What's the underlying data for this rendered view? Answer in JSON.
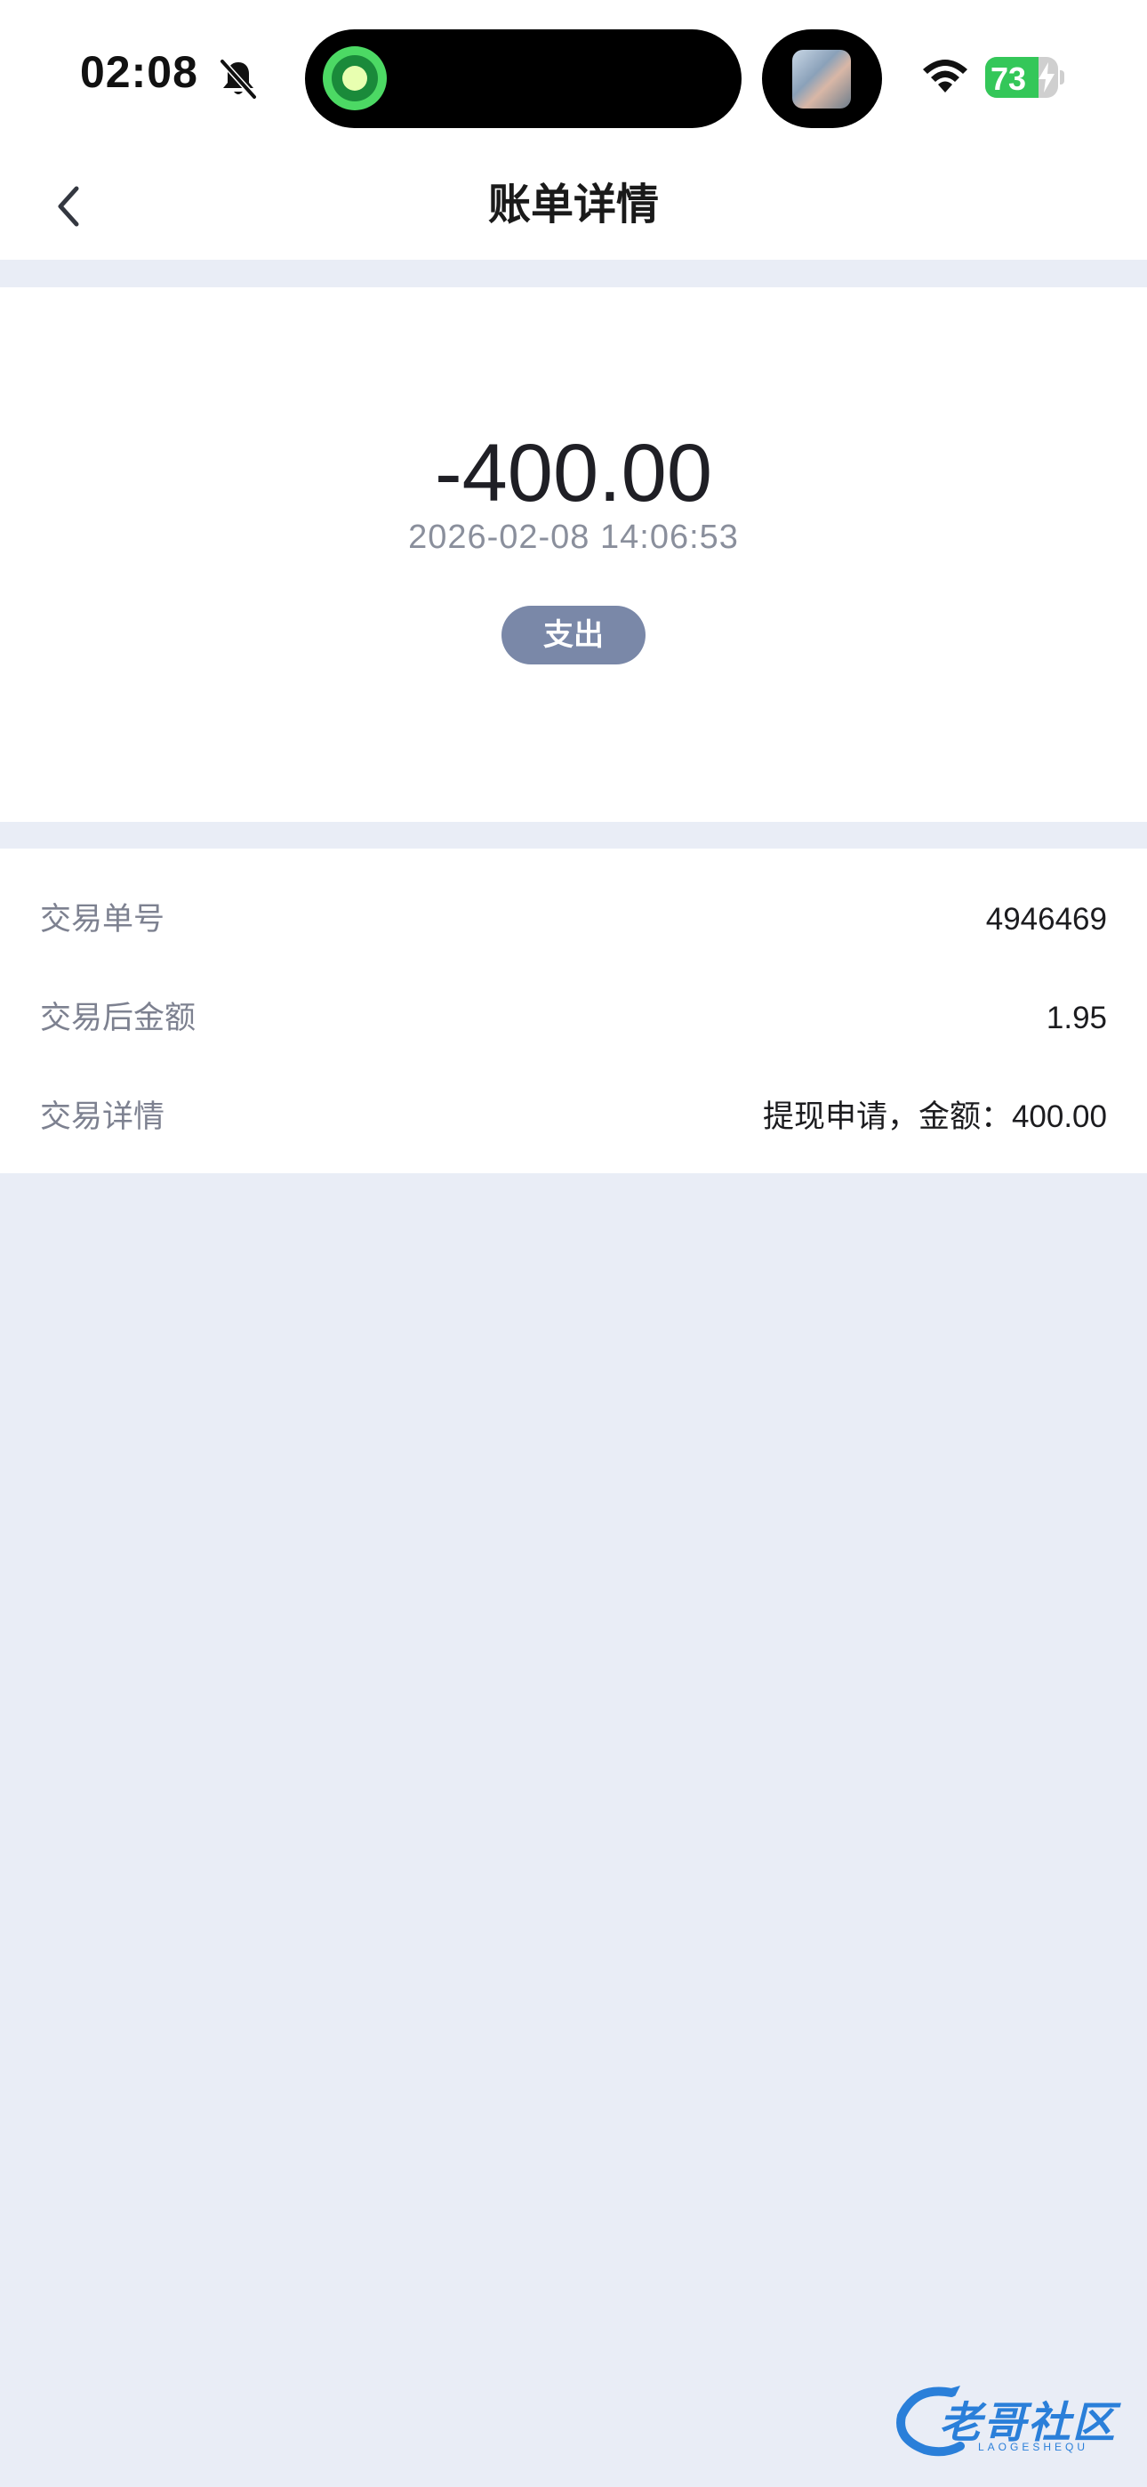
{
  "status_bar": {
    "time": "02:08",
    "battery_level": "73",
    "battery_fraction": 0.73,
    "battery_color": "#34c759"
  },
  "nav": {
    "title": "账单详情",
    "back_icon": "chevron-left-icon"
  },
  "summary": {
    "amount": "-400.00",
    "timestamp": "2026-02-08 14:06:53",
    "type_badge": "支出",
    "badge_color": "#7a88a8"
  },
  "details": [
    {
      "label": "交易单号",
      "value": "4946469"
    },
    {
      "label": "交易后金额",
      "value": "1.95"
    },
    {
      "label": "交易详情",
      "value": "提现申请，金额：400.00"
    }
  ],
  "watermark": {
    "text": "老哥社区",
    "sub": "LAOGESHEQU"
  },
  "colors": {
    "background": "#e9edf6",
    "card": "#ffffff",
    "label_text": "#7d8190",
    "value_text": "#1c1c1f"
  }
}
